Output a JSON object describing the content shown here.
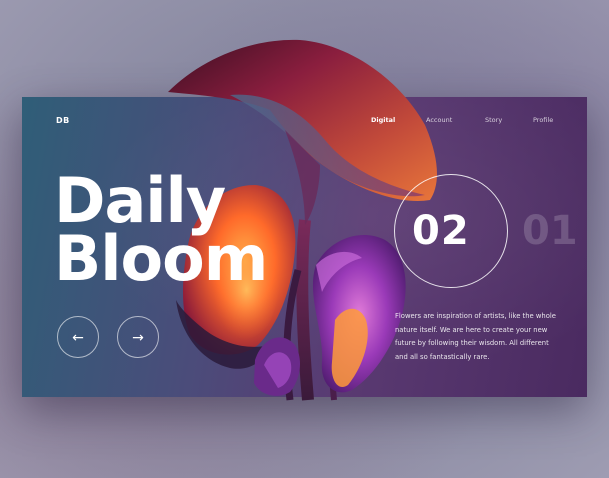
{
  "brand": {
    "logo": "DB"
  },
  "nav": {
    "items": [
      {
        "label": "Digital",
        "active": true
      },
      {
        "label": "Account",
        "active": false
      },
      {
        "label": "Story",
        "active": false
      },
      {
        "label": "Profile",
        "active": false
      }
    ]
  },
  "hero": {
    "title_line1": "Daily",
    "title_line2": "Bloom",
    "current_slide": "02",
    "next_slide": "01",
    "description_lines": [
      "Flowers are inspiration of artists, like the whole",
      "nature itself. We are here to create your new",
      "future by following their wisdom. All different",
      "and all so fantastically rare."
    ]
  },
  "controls": {
    "prev_icon": "arrow-left-icon",
    "next_icon": "arrow-right-icon",
    "prev_glyph": "←",
    "next_glyph": "→"
  },
  "colors": {
    "card_start": "#2f5e78",
    "card_end": "#4a2a60",
    "petal_orange": "#ff7a2a",
    "petal_purple": "#9a3ab8",
    "petal_crimson": "#8a1e3e",
    "text": "#ffffff"
  }
}
